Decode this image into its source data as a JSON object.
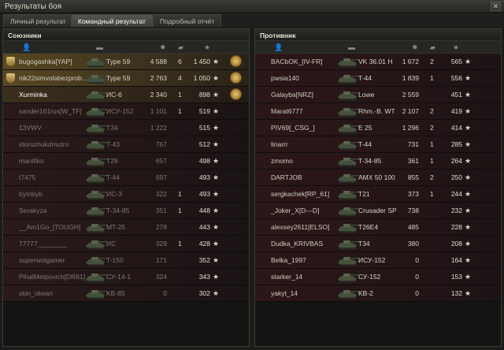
{
  "window": {
    "title": "Результаты боя",
    "close_label": "✕"
  },
  "tabs": [
    {
      "label": "Личный результат"
    },
    {
      "label": "Командный результат"
    },
    {
      "label": "Подробный отчёт"
    }
  ],
  "allies": {
    "title": "Союзники",
    "rows": [
      {
        "name": "bugogashka[YAP]",
        "vehicle": "Type 59",
        "damage": "4 588",
        "kills": "6",
        "xp": "1 450",
        "squad": true,
        "medal": true
      },
      {
        "name": "nik22simvolabezprob...",
        "vehicle": "Type 59",
        "damage": "2 763",
        "kills": "4",
        "xp": "1 050",
        "squad": true,
        "medal": true
      },
      {
        "name": "Xurminka",
        "vehicle": "ИС-6",
        "damage": "2 340",
        "kills": "1",
        "xp": "898",
        "me": true,
        "medal": true
      },
      {
        "name": "sander161rus[W_TF]",
        "vehicle": "ИСУ-152",
        "damage": "1 101",
        "kills": "1",
        "xp": "519"
      },
      {
        "name": "13VWV",
        "vehicle": "T34",
        "damage": "1 222",
        "kills": "",
        "xp": "515"
      },
      {
        "name": "storozhukdmutro",
        "vehicle": "T-43",
        "damage": "767",
        "kills": "",
        "xp": "512"
      },
      {
        "name": "manifiko",
        "vehicle": "T29",
        "damage": "657",
        "kills": "",
        "xp": "498"
      },
      {
        "name": "t7475",
        "vehicle": "T-44",
        "damage": "697",
        "kills": "",
        "xp": "493"
      },
      {
        "name": "bymbyb",
        "vehicle": "ИС-3",
        "damage": "322",
        "kills": "1",
        "xp": "493"
      },
      {
        "name": "Serakyza",
        "vehicle": "T-34-85",
        "damage": "351",
        "kills": "1",
        "xp": "448"
      },
      {
        "name": "__Am1Go_[TOUGH]",
        "vehicle": "MT-25",
        "damage": "278",
        "kills": "",
        "xp": "443"
      },
      {
        "name": "77777________",
        "vehicle": "ИС",
        "damage": "329",
        "kills": "1",
        "xp": "428"
      },
      {
        "name": "superwotgamer",
        "vehicle": "T-150",
        "damage": "171",
        "kills": "",
        "xp": "352"
      },
      {
        "name": "PihalMetpovich[DR61]",
        "vehicle": "СУ-14-1",
        "damage": "324",
        "kills": "",
        "xp": "343"
      },
      {
        "name": "skin_okean",
        "vehicle": "KB-85",
        "damage": "0",
        "kills": "",
        "xp": "302"
      }
    ]
  },
  "enemies": {
    "title": "Противник",
    "rows": [
      {
        "name": "BACbOK_[IV-FR]",
        "vehicle": "VK 36.01 H",
        "damage": "1 672",
        "kills": "2",
        "xp": "565"
      },
      {
        "name": "pwsia140",
        "vehicle": "T-44",
        "damage": "1 839",
        "kills": "1",
        "xp": "556"
      },
      {
        "name": "Galayba[NRZ]",
        "vehicle": "Lowe",
        "damage": "2 559",
        "kills": "",
        "xp": "451"
      },
      {
        "name": "Marat6777",
        "vehicle": "Rhm.-B. WT",
        "damage": "2 107",
        "kills": "2",
        "xp": "419"
      },
      {
        "name": "PIV69[_CSG_]",
        "vehicle": "E 25",
        "damage": "1 296",
        "kills": "2",
        "xp": "414"
      },
      {
        "name": "linarrr",
        "vehicle": "T-44",
        "damage": "731",
        "kills": "1",
        "xp": "285"
      },
      {
        "name": "zmomo",
        "vehicle": "T-34-85",
        "damage": "361",
        "kills": "1",
        "xp": "264"
      },
      {
        "name": "DARTJOB",
        "vehicle": "AMX 50 100",
        "damage": "855",
        "kills": "2",
        "xp": "250"
      },
      {
        "name": "sergkachek[RP_61]",
        "vehicle": "T21",
        "damage": "373",
        "kills": "1",
        "xp": "244"
      },
      {
        "name": "_Joker_X[D---D]",
        "vehicle": "Crusader SP",
        "damage": "738",
        "kills": "",
        "xp": "232"
      },
      {
        "name": "alexsey2611[ELSO]",
        "vehicle": "T26E4",
        "damage": "485",
        "kills": "",
        "xp": "228"
      },
      {
        "name": "Dudka_KRIVBAS",
        "vehicle": "T34",
        "damage": "380",
        "kills": "",
        "xp": "208"
      },
      {
        "name": "Belka_1997",
        "vehicle": "ИСУ-152",
        "damage": "0",
        "kills": "",
        "xp": "164"
      },
      {
        "name": "starker_14",
        "vehicle": "СУ-152",
        "damage": "0",
        "kills": "",
        "xp": "153"
      },
      {
        "name": "yakyt_14",
        "vehicle": "KB-2",
        "damage": "0",
        "kills": "",
        "xp": "132"
      }
    ]
  },
  "icons": {
    "player_col": "person-icon",
    "tank_col": "tank-icon",
    "damage_col": "damage-icon",
    "kills_col": "kills-icon",
    "xp_col": "star-icon",
    "star_glyph": "★"
  },
  "colors": {
    "accent": "#e0c07a",
    "row_red": "#2a1a1a",
    "squad_gold": "#5a4823"
  }
}
